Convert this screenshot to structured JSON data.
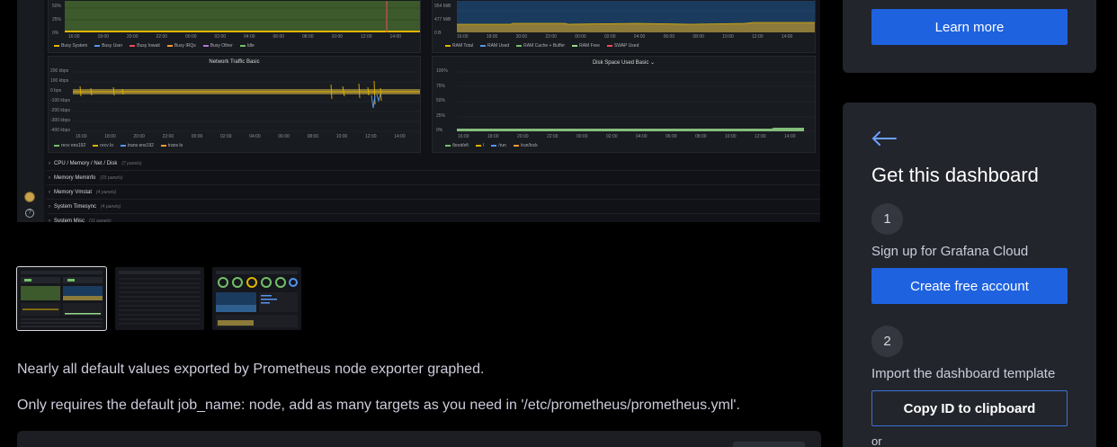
{
  "preview": {
    "top_left": {
      "yticks": [
        "50%",
        "25%",
        "0%"
      ],
      "xticks": [
        "16:00",
        "18:00",
        "20:00",
        "22:00",
        "00:00",
        "02:00",
        "04:00",
        "06:00",
        "08:00",
        "10:00",
        "12:00",
        "14:00"
      ],
      "legend": [
        {
          "label": "Busy System",
          "color": "#e0b400"
        },
        {
          "label": "Busy User",
          "color": "#5794f2"
        },
        {
          "label": "Busy Iowait",
          "color": "#f2495c"
        },
        {
          "label": "Busy IRQs",
          "color": "#ff9830"
        },
        {
          "label": "Busy Other",
          "color": "#b877d9"
        },
        {
          "label": "Idle",
          "color": "#73bf69"
        }
      ]
    },
    "top_right": {
      "yticks": [
        "954 MiB",
        "477 MiB",
        "0 B"
      ],
      "xticks": [
        "16:00",
        "18:00",
        "20:00",
        "22:00",
        "00:00",
        "02:00",
        "04:00",
        "06:00",
        "08:00",
        "10:00",
        "12:00",
        "14:00"
      ],
      "legend": [
        {
          "label": "RAM Total",
          "color": "#e0b400"
        },
        {
          "label": "RAM Used",
          "color": "#5794f2"
        },
        {
          "label": "RAM Cache + Buffer",
          "color": "#73bf69"
        },
        {
          "label": "RAM Free",
          "color": "#96d98d"
        },
        {
          "label": "SWAP Used",
          "color": "#f2495c"
        }
      ]
    },
    "network": {
      "title": "Network Traffic Basic",
      "yticks": [
        "200 kbps",
        "100 kbps",
        "0 bps",
        "-100 kbps",
        "-200 kbps",
        "-300 kbps",
        "-400 kbps"
      ],
      "xticks": [
        "16:00",
        "18:00",
        "20:00",
        "22:00",
        "00:00",
        "02:00",
        "04:00",
        "06:00",
        "08:00",
        "10:00",
        "12:00",
        "14:00"
      ],
      "legend": [
        {
          "label": "recv ens192",
          "color": "#73bf69"
        },
        {
          "label": "recv lo",
          "color": "#e0b400"
        },
        {
          "label": "trans ens192",
          "color": "#5794f2"
        },
        {
          "label": "trans lo",
          "color": "#ff9830"
        }
      ]
    },
    "disk": {
      "title": "Disk Space Used Basic",
      "yticks": [
        "100%",
        "75%",
        "50%",
        "25%",
        "0%"
      ],
      "xticks": [
        "16:00",
        "18:00",
        "20:00",
        "22:00",
        "00:00",
        "02:00",
        "04:00",
        "06:00",
        "08:00",
        "10:00",
        "12:00",
        "14:00"
      ],
      "legend": [
        {
          "label": "/boot/efi",
          "color": "#73bf69"
        },
        {
          "label": "/",
          "color": "#e0b400"
        },
        {
          "label": "/run",
          "color": "#5794f2"
        },
        {
          "label": "/run/lock",
          "color": "#ff9830"
        }
      ]
    },
    "rows": [
      {
        "title": "CPU / Memory / Net / Disk",
        "panels": "(7 panels)"
      },
      {
        "title": "Memory Meminfo",
        "panels": "(15 panels)"
      },
      {
        "title": "Memory Vmstat",
        "panels": "(4 panels)"
      },
      {
        "title": "System Timesync",
        "panels": "(4 panels)"
      },
      {
        "title": "System Misc",
        "panels": "(11 panels)"
      }
    ]
  },
  "description": {
    "line1": "Nearly all default values exported by Prometheus node exporter graphed.",
    "line2": "Only requires the default job_name: node, add as many targets as you need in '/etc/prometheus/prometheus.yml'."
  },
  "sidebar": {
    "learn_more": "Learn more",
    "title": "Get this dashboard",
    "step1": {
      "number": "1",
      "label": "Sign up for Grafana Cloud",
      "button": "Create free account"
    },
    "step2": {
      "number": "2",
      "label": "Import the dashboard template",
      "button": "Copy ID to clipboard"
    },
    "or_text": "or"
  },
  "colors": {
    "accent": "#1f62e0",
    "card": "#22252b",
    "background": "#000000"
  }
}
